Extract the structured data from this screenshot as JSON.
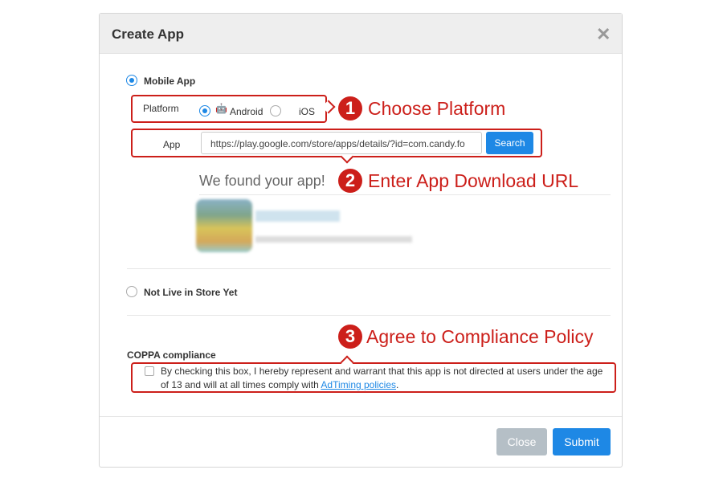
{
  "dialog": {
    "title": "Create App",
    "close_icon": "close-x-icon"
  },
  "source": {
    "mobile_app": "Mobile App",
    "not_live": "Not Live in Store Yet",
    "selected": "Mobile App"
  },
  "platform": {
    "label": "Platform",
    "options": [
      "Android",
      "iOS"
    ],
    "selected": "Android"
  },
  "app": {
    "label": "App",
    "url": "https://play.google.com/store/apps/details/?id=com.candy.fo",
    "search": "Search"
  },
  "result": {
    "found": "We found your app!"
  },
  "annotations": [
    {
      "num": "1",
      "text": "Choose Platform"
    },
    {
      "num": "2",
      "text": "Enter App Download URL"
    },
    {
      "num": "3",
      "text": "Agree to Compliance Policy"
    }
  ],
  "coppa": {
    "heading": "COPPA compliance",
    "text_before": "By checking this box, I hereby represent and warrant that this app is not directed at users under the age of 13 and will at all times comply with ",
    "link": "AdTiming policies",
    "text_after": ".",
    "checked": false
  },
  "footer": {
    "close": "Close",
    "submit": "Submit"
  },
  "colors": {
    "accent": "#1e88e5",
    "annotation": "#cc1f1a",
    "close_disabled": "#b5bfc6"
  }
}
